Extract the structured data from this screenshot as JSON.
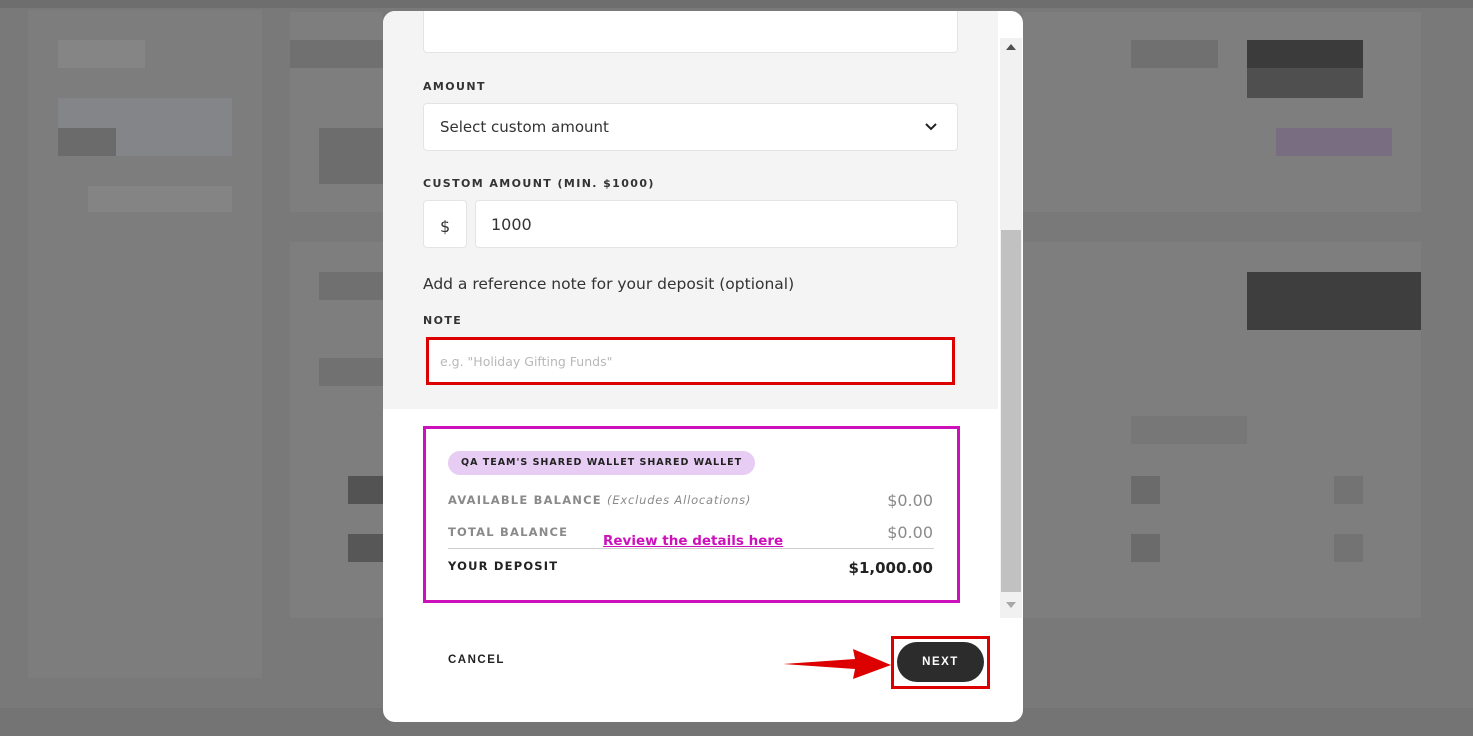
{
  "form": {
    "amount_label": "AMOUNT",
    "amount_select_value": "Select custom amount",
    "custom_amount_label": "CUSTOM AMOUNT (MIN. $1000)",
    "currency_symbol": "$",
    "custom_amount_value": "1000",
    "reference_prompt": "Add a reference note for your deposit (optional)",
    "note_label": "NOTE",
    "note_placeholder": "e.g. \"Holiday Gifting Funds\""
  },
  "summary": {
    "wallet_badge": "QA TEAM'S SHARED WALLET SHARED WALLET",
    "available_balance_label": "AVAILABLE BALANCE",
    "available_balance_note": "(Excludes Allocations)",
    "available_balance_value": "$0.00",
    "total_balance_label": "TOTAL BALANCE",
    "total_balance_value": "$0.00",
    "your_deposit_label": "YOUR DEPOSIT",
    "your_deposit_value": "$1,000.00"
  },
  "annotation": {
    "review_text": "Review the details here"
  },
  "actions": {
    "cancel_label": "CANCEL",
    "next_label": "NEXT"
  },
  "colors": {
    "annotation_magenta": "#cc11bb",
    "annotation_red": "#dd0000",
    "badge_lavender": "#e7ccf3",
    "next_button": "#2c2c2c"
  },
  "icons": {
    "dropdown": "chevron-down-icon",
    "scroll_up": "scroll-up-arrow-icon",
    "scroll_down": "scroll-down-arrow-icon",
    "pointer": "red-arrow-icon"
  }
}
